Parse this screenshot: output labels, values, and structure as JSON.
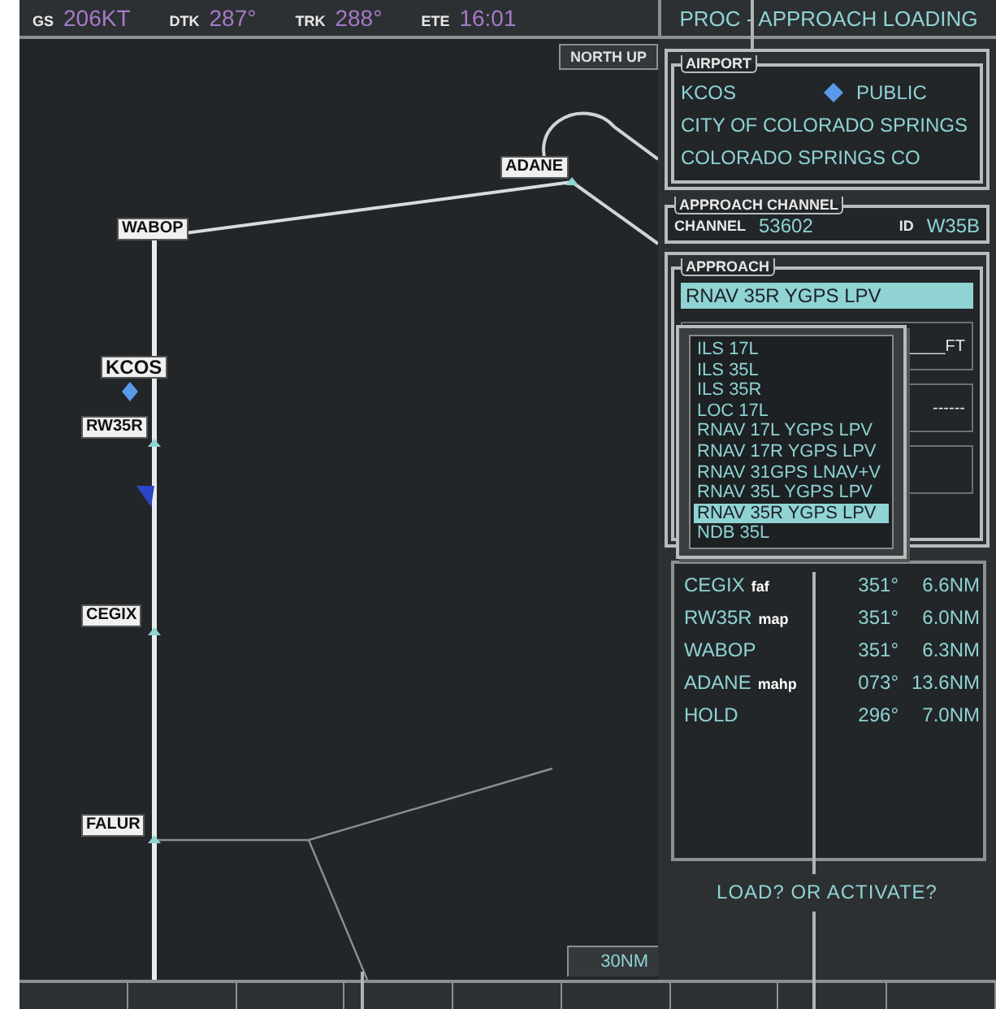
{
  "nav_bar": {
    "fields": [
      {
        "label": "GS",
        "value": "206KT"
      },
      {
        "label": "DTK",
        "value": "287°"
      },
      {
        "label": "TRK",
        "value": "288°"
      },
      {
        "label": "ETE",
        "value": "16:01"
      }
    ]
  },
  "page_title": "PROC - APPROACH LOADING",
  "map": {
    "orientation": "NORTH UP",
    "range": "30NM",
    "waypoints": [
      {
        "name": "ADANE",
        "kind": "fix"
      },
      {
        "name": "WABOP",
        "kind": "fix"
      },
      {
        "name": "KCOS",
        "kind": "airport"
      },
      {
        "name": "RW35R",
        "kind": "fix"
      },
      {
        "name": "CEGIX",
        "kind": "fix"
      },
      {
        "name": "FALUR",
        "kind": "fix"
      }
    ]
  },
  "airport": {
    "title": "AIRPORT",
    "ident": "KCOS",
    "type": "PUBLIC",
    "name": "CITY OF COLORADO SPRINGS",
    "city": "COLORADO SPRINGS CO"
  },
  "approach_channel": {
    "title": "APPROACH CHANNEL",
    "channel_label": "CHANNEL",
    "channel": "53602",
    "id_label": "ID",
    "id": "W35B"
  },
  "approach": {
    "title": "APPROACH",
    "value": "RNAV 35R YGPS LPV",
    "partly_hidden_fields": [
      "____FT",
      "------"
    ],
    "options": [
      {
        "label": "ILS 17L",
        "selected": false
      },
      {
        "label": "ILS 35L",
        "selected": false
      },
      {
        "label": "ILS 35R",
        "selected": false
      },
      {
        "label": "LOC 17L",
        "selected": false
      },
      {
        "label": "RNAV 17L YGPS LPV",
        "selected": false
      },
      {
        "label": "RNAV 17R YGPS LPV",
        "selected": false
      },
      {
        "label": "RNAV 31GPS LNAV+V",
        "selected": false
      },
      {
        "label": "RNAV 35L YGPS LPV",
        "selected": false
      },
      {
        "label": "RNAV 35R YGPS LPV",
        "selected": true
      },
      {
        "label": "NDB 35L",
        "selected": false
      }
    ]
  },
  "legs": [
    {
      "name": "CEGIX",
      "role": "faf",
      "course": "351°",
      "distance": "6.6NM"
    },
    {
      "name": "RW35R",
      "role": "map",
      "course": "351°",
      "distance": "6.0NM"
    },
    {
      "name": "WABOP",
      "course": "351°",
      "distance": "6.3NM"
    },
    {
      "name": "ADANE",
      "role": "mahp",
      "course": "073°",
      "distance": "13.6NM"
    },
    {
      "name": "HOLD",
      "course": "296°",
      "distance": "7.0NM"
    }
  ],
  "prompt": "LOAD? OR ACTIVATE?"
}
